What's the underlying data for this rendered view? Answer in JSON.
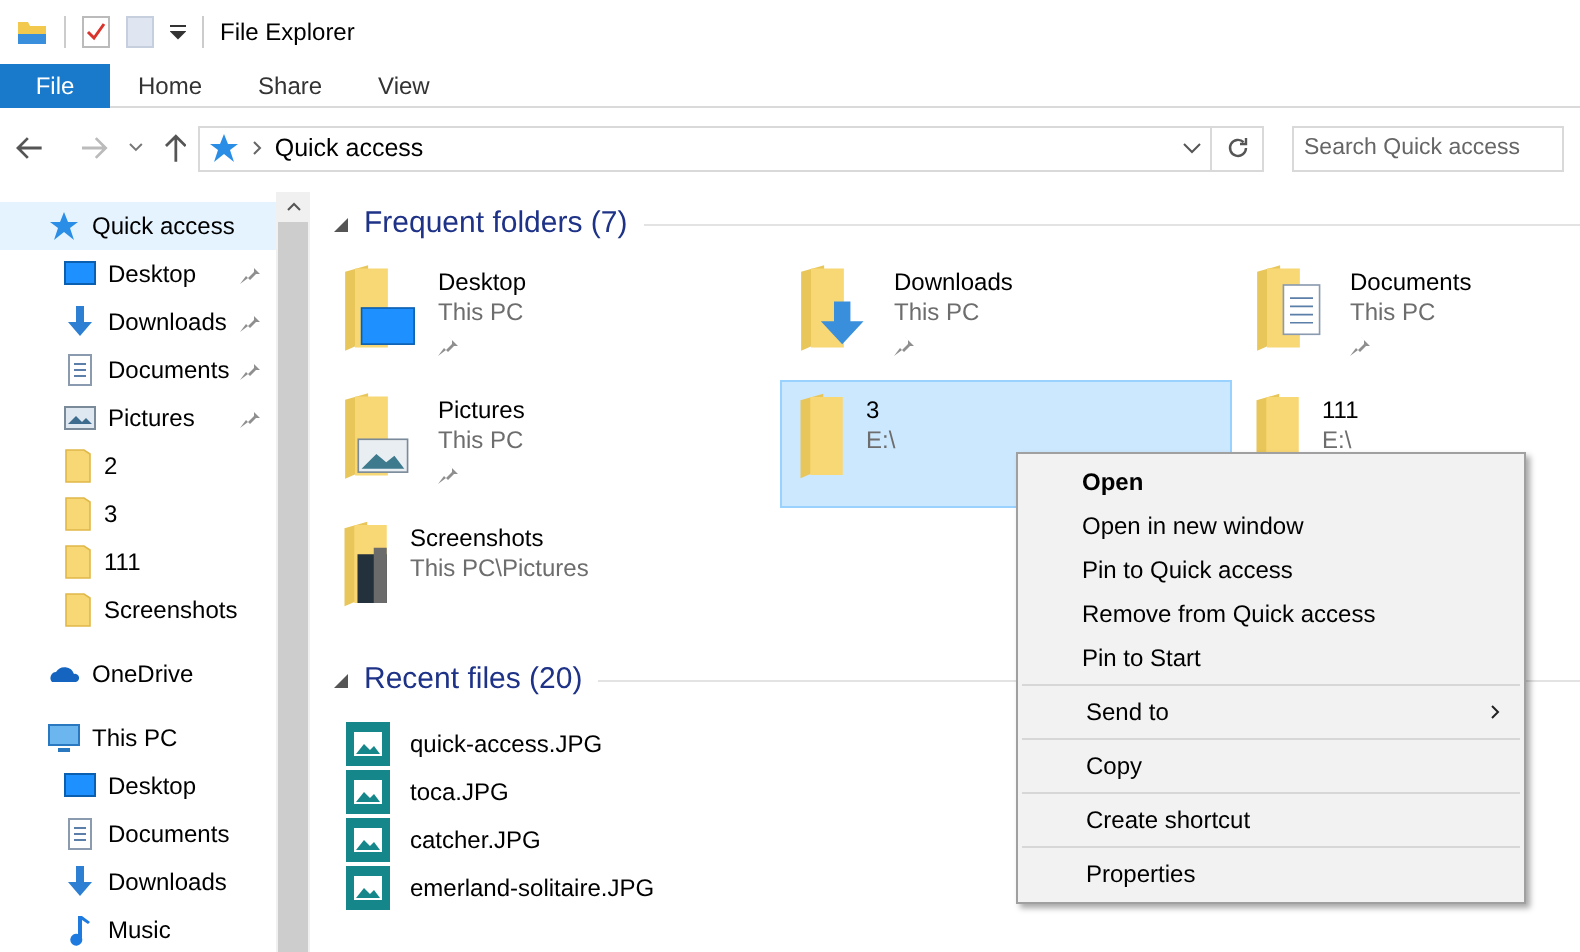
{
  "window": {
    "title": "File Explorer"
  },
  "ribbon_tabs": [
    {
      "label": "File",
      "selected": true
    },
    {
      "label": "Home",
      "selected": false
    },
    {
      "label": "Share",
      "selected": false
    },
    {
      "label": "View",
      "selected": false
    }
  ],
  "address": {
    "path": "Quick access",
    "search_placeholder": "Search Quick access"
  },
  "sidebar": {
    "items": [
      {
        "label": "Quick access",
        "kind": "star",
        "selected": true,
        "children": [
          {
            "label": "Desktop",
            "kind": "desktop",
            "pinned": true
          },
          {
            "label": "Downloads",
            "kind": "download",
            "pinned": true
          },
          {
            "label": "Documents",
            "kind": "document",
            "pinned": true
          },
          {
            "label": "Pictures",
            "kind": "pictures",
            "pinned": true
          },
          {
            "label": "2",
            "kind": "folder",
            "pinned": false
          },
          {
            "label": "3",
            "kind": "folder",
            "pinned": false
          },
          {
            "label": "111",
            "kind": "folder",
            "pinned": false
          },
          {
            "label": "Screenshots",
            "kind": "folder",
            "pinned": false
          }
        ]
      },
      {
        "label": "OneDrive",
        "kind": "cloud",
        "selected": false
      },
      {
        "label": "This PC",
        "kind": "pc",
        "selected": false,
        "children": [
          {
            "label": "Desktop",
            "kind": "desktop",
            "pinned": false
          },
          {
            "label": "Documents",
            "kind": "document",
            "pinned": false
          },
          {
            "label": "Downloads",
            "kind": "download",
            "pinned": false
          },
          {
            "label": "Music",
            "kind": "music",
            "pinned": false
          }
        ]
      }
    ]
  },
  "frequent_folders": {
    "title": "Frequent folders (7)",
    "expanded": true,
    "items": [
      {
        "name": "Desktop",
        "location": "This PC",
        "kind": "desktop",
        "pinned": true,
        "selected": false
      },
      {
        "name": "Downloads",
        "location": "This PC",
        "kind": "download",
        "pinned": true,
        "selected": false
      },
      {
        "name": "Documents",
        "location": "This PC",
        "kind": "document",
        "pinned": true,
        "selected": false
      },
      {
        "name": "Pictures",
        "location": "This PC",
        "kind": "pictures",
        "pinned": true,
        "selected": false
      },
      {
        "name": "3",
        "location": "E:\\",
        "kind": "plain",
        "pinned": false,
        "selected": true
      },
      {
        "name": "111",
        "location": "E:\\",
        "kind": "plain",
        "selected": false
      },
      {
        "name": "Screenshots",
        "location": "This PC\\Pictures",
        "kind": "screenshots",
        "pinned": false,
        "selected": false
      }
    ]
  },
  "recent_files": {
    "title": "Recent files (20)",
    "expanded": true,
    "items": [
      "quick-access.JPG",
      "toca.JPG",
      "catcher.JPG",
      "emerland-solitaire.JPG"
    ]
  },
  "context_menu": {
    "groups": [
      [
        {
          "label": "Open",
          "default": true,
          "submenu": false
        },
        {
          "label": "Open in new window",
          "default": false,
          "submenu": false
        },
        {
          "label": "Pin to Quick access",
          "default": false,
          "submenu": false
        },
        {
          "label": "Remove from Quick access",
          "default": false,
          "submenu": false
        },
        {
          "label": "Pin to Start",
          "default": false,
          "submenu": false
        }
      ],
      [
        {
          "label": "Send to",
          "default": false,
          "submenu": true
        }
      ],
      [
        {
          "label": "Copy",
          "default": false,
          "submenu": false
        }
      ],
      [
        {
          "label": "Create shortcut",
          "default": false,
          "submenu": false
        }
      ],
      [
        {
          "label": "Properties",
          "default": false,
          "submenu": false
        }
      ]
    ]
  }
}
